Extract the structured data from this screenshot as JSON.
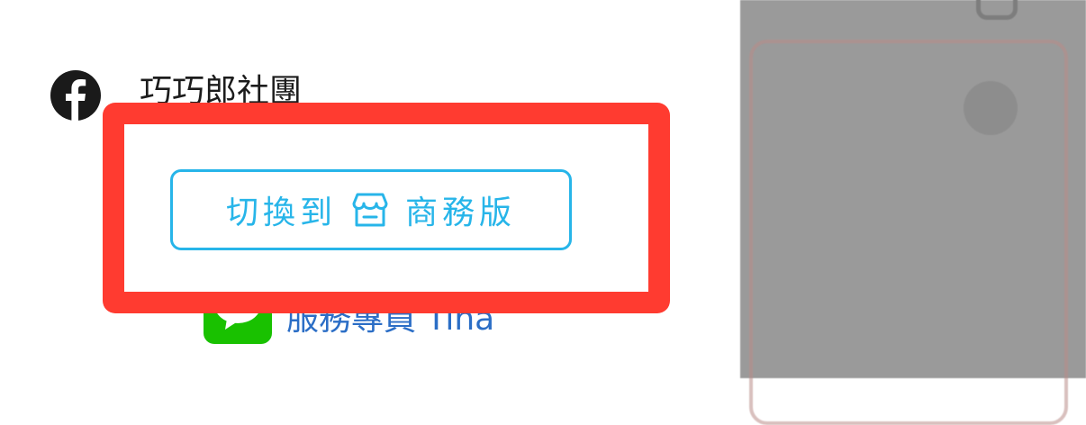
{
  "social": {
    "facebook_label": "巧巧郎社團",
    "facebook_icon": "facebook-icon",
    "line_label": "服務專員 Tina",
    "line_icon": "line-chat-icon"
  },
  "switch": {
    "prefix": "切換到",
    "suffix": "商務版",
    "icon": "storefront-icon"
  },
  "colors": {
    "accent": "#27b5e9",
    "highlight": "#ff3b30",
    "line_green": "#19c100",
    "link_blue": "#2b6ec6"
  }
}
